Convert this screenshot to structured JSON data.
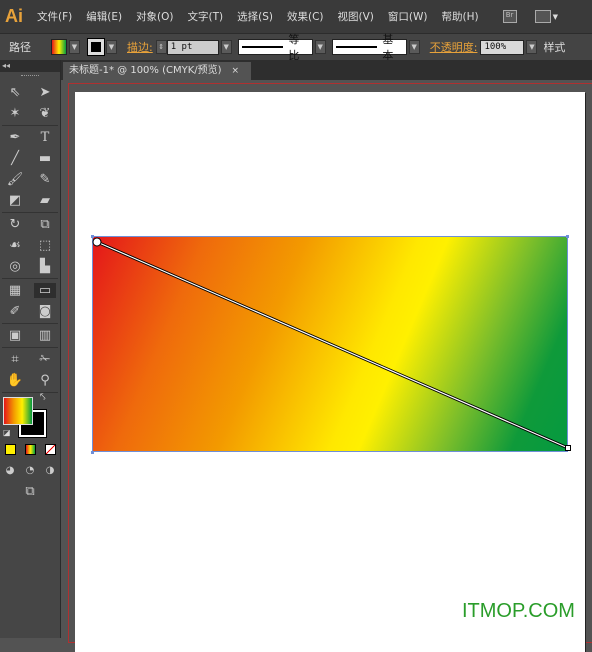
{
  "app": {
    "logo": "Ai"
  },
  "menu": [
    "文件(F)",
    "编辑(E)",
    "对象(O)",
    "文字(T)",
    "选择(S)",
    "效果(C)",
    "视图(V)",
    "窗口(W)",
    "帮助(H)"
  ],
  "menu_icons": {
    "bridge": "Br",
    "arrange": "arrange-documents-icon"
  },
  "options": {
    "selection_type": "路径",
    "stroke_label": "描边:",
    "stroke_weight": "1 pt",
    "profile": "等比",
    "brush": "基本",
    "opacity_label": "不透明度:",
    "opacity": "100%",
    "style_label": "样式"
  },
  "tab": {
    "title": "未标题-1* @ 100% (CMYK/预览)",
    "close": "×"
  },
  "toolbox": {
    "collapse": "◂◂"
  },
  "gradient": {
    "colors": [
      "#e4161a",
      "#f39a00",
      "#fff000",
      "#059a40"
    ]
  },
  "watermark": "ITMOP.COM"
}
